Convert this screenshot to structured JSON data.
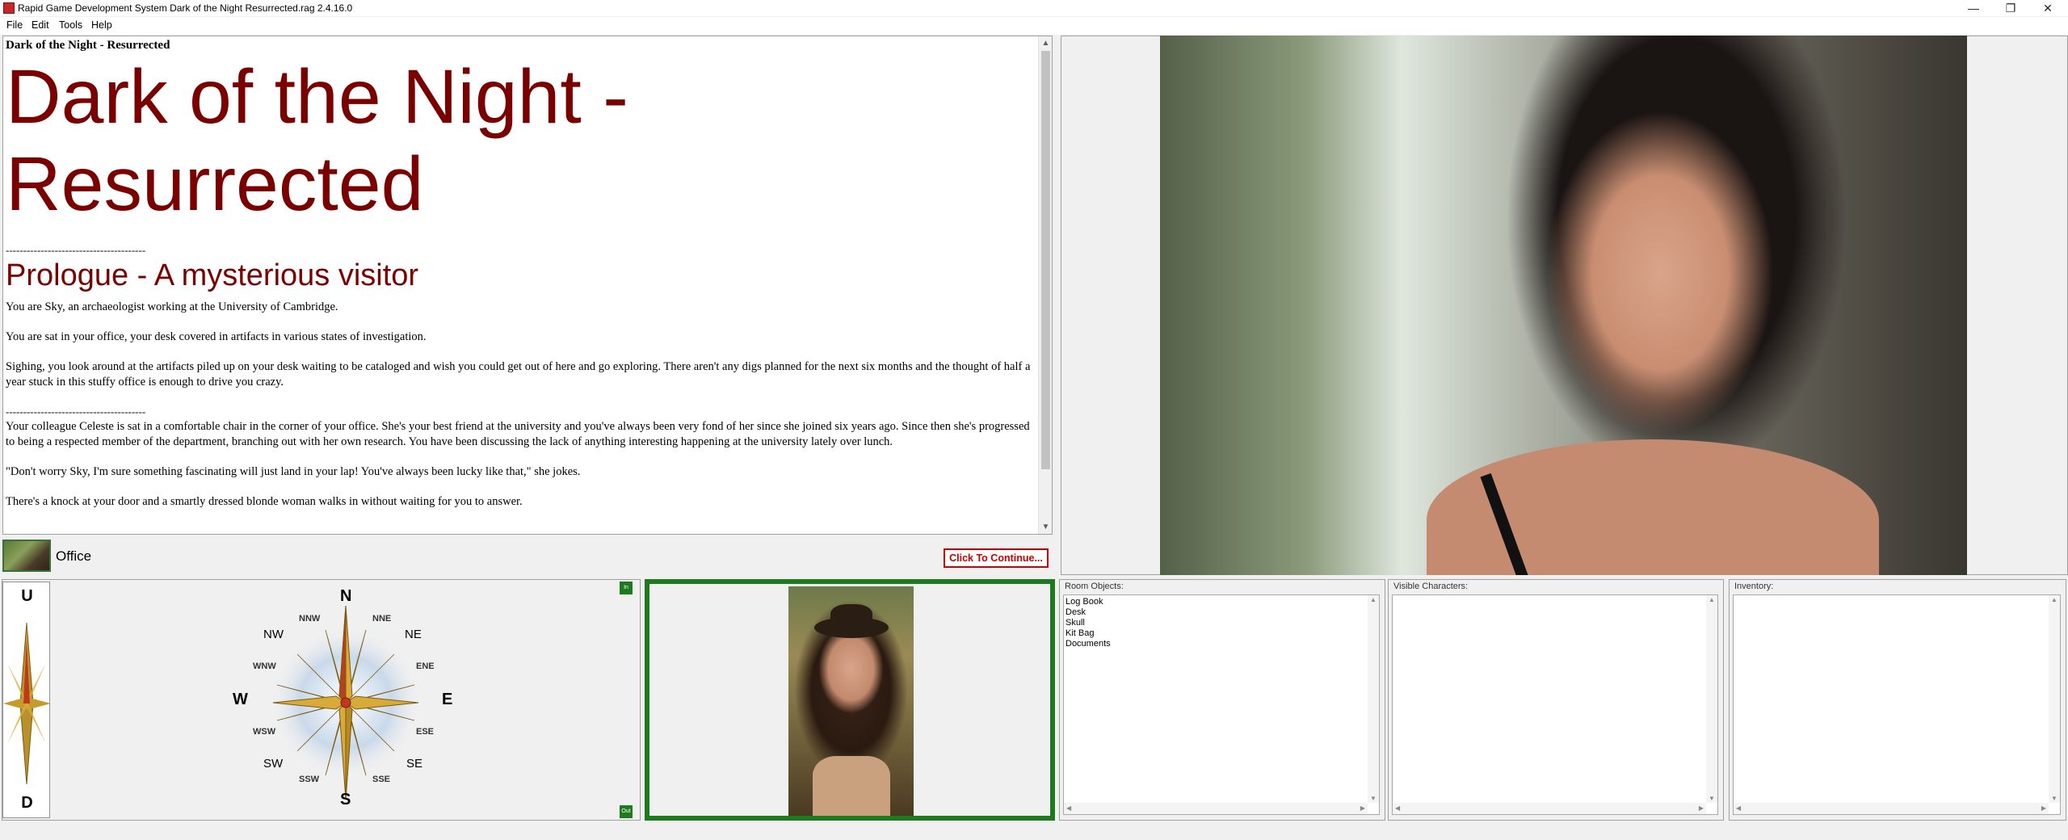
{
  "window": {
    "title": "Rapid Game Development System Dark of the Night Resurrected.rag 2.4.16.0",
    "minimize": "—",
    "restore": "❐",
    "close": "✕"
  },
  "menu": [
    "File",
    "Edit",
    "Tools",
    "Help"
  ],
  "story": {
    "heading": "Dark of the Night - Resurrected",
    "title_line1": "Dark of the Night -",
    "title_line2": "Resurrected",
    "divider1": "----------------------------------------",
    "subtitle": "Prologue - A mysterious visitor",
    "paragraphs": [
      "You are Sky, an archaeologist working at the University of Cambridge.",
      "You are sat in your office, your desk covered in artifacts in various states of investigation.",
      "Sighing, you look around at the artifacts piled up on your desk waiting to be cataloged and wish you could get out of here and go exploring. There aren't any digs planned for the next six months and the thought of half a year stuck in this stuffy office is enough to drive you crazy."
    ],
    "divider2": "----------------------------------------",
    "paragraphs2": [
      "Your colleague Celeste is sat in a comfortable chair in the corner of your office. She's your best friend at the university and you've always been very fond of her since she joined six years ago. Since then she's progressed to being a respected member of the department, branching out with her own research. You have been discussing the lack of anything interesting happening at the university lately over lunch.",
      "\"Don't worry Sky, I'm sure something fascinating will just land in your lap! You've always been lucky like that,\" she jokes.",
      "There's a knock at your door and a smartly dressed blonde woman walks in without waiting for you to answer."
    ]
  },
  "location": {
    "room_name": "Office",
    "continue_label": "Click To Continue..."
  },
  "compass": {
    "up": "U",
    "down": "D",
    "in": "In",
    "out": "Out",
    "n": "N",
    "s": "S",
    "e": "E",
    "w": "W",
    "nw": "NW",
    "ne": "NE",
    "sw": "SW",
    "se": "SE",
    "nnw": "NNW",
    "nne": "NNE",
    "ene": "ENE",
    "ese": "ESE",
    "wnw": "WNW",
    "wsw": "WSW",
    "ssw": "SSW",
    "sse": "SSE"
  },
  "room_objects": {
    "caption": "Room Objects:",
    "items": [
      "Log Book",
      "Desk",
      "Skull",
      "Kit Bag",
      "Documents"
    ]
  },
  "visible_characters": {
    "caption": "Visible Characters:",
    "items": []
  },
  "inventory": {
    "caption": "Inventory:",
    "items": []
  },
  "colors": {
    "title_red": "#7a0000",
    "continue_red": "#cc0000",
    "player_frame_green": "#1f7a1f"
  }
}
